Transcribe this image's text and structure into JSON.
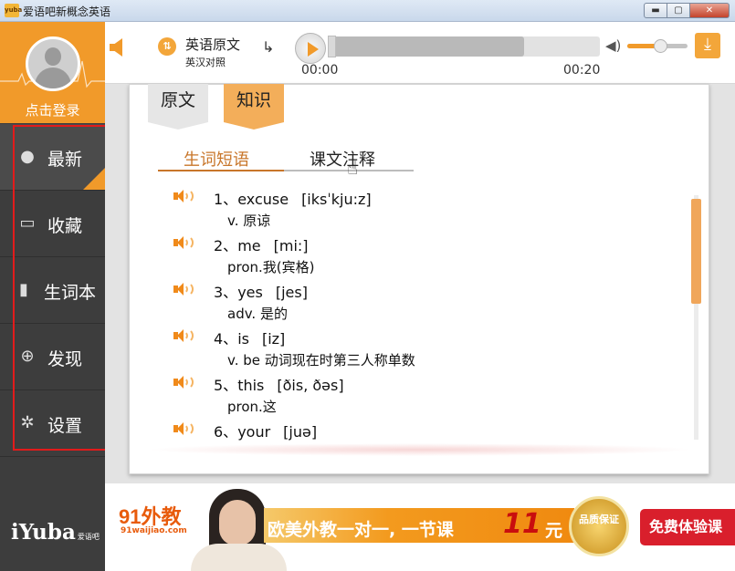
{
  "window": {
    "title": "爱语吧新概念英语",
    "logo_text": "yuba",
    "min_glyph": "▬",
    "max_glyph": "▢",
    "close_glyph": "✕"
  },
  "sidebar": {
    "login_label": "点击登录",
    "items": [
      {
        "label": "最新",
        "icon": "new-icon",
        "glyph": "●"
      },
      {
        "label": "收藏",
        "icon": "folder-icon",
        "glyph": "▭"
      },
      {
        "label": "生词本",
        "icon": "book-icon",
        "glyph": "▮"
      },
      {
        "label": "发现",
        "icon": "compass-icon",
        "glyph": "⊕"
      },
      {
        "label": "设置",
        "icon": "gear-icon",
        "glyph": "✲"
      }
    ],
    "brand": "iYuba",
    "brand_small": "爱语吧"
  },
  "player": {
    "mode_glyph": "⇅",
    "mode_title": "英语原文",
    "mode_subtitle": "英汉对照",
    "repeat_glyph": "↳",
    "current_time": "00:00",
    "total_time": "00:20",
    "progress": 0.72,
    "volume": 0.55,
    "volume_glyph": "◀)",
    "download_glyph": "⤓"
  },
  "tabs": {
    "original": "原文",
    "knowledge": "知识"
  },
  "subtabs": {
    "words": "生词短语",
    "notes": "课文注释"
  },
  "words": [
    {
      "index": "1、",
      "word": "excuse",
      "phonetic": "[iksˈkju:z]",
      "definition": "v. 原谅"
    },
    {
      "index": "2、",
      "word": "me",
      "phonetic": "[mi:]",
      "definition": "pron.我(宾格)"
    },
    {
      "index": "3、",
      "word": "yes",
      "phonetic": "[jes]",
      "definition": "adv. 是的"
    },
    {
      "index": "4、",
      "word": "is",
      "phonetic": "[iz]",
      "definition": "v. be 动词现在时第三人称单数"
    },
    {
      "index": "5、",
      "word": "this",
      "phonetic": "[ðis, ðəs]",
      "definition": "pron.这"
    },
    {
      "index": "6、",
      "word": "your",
      "phonetic": "[juə]",
      "definition": ""
    }
  ],
  "ad": {
    "logo": "91外教",
    "site": "91waijiao.com",
    "slogan": "欧美外教一对一, 一节课",
    "price": "11",
    "unit": "元",
    "seal": "品质保证",
    "cta": "免费体验课"
  },
  "colors": {
    "accent": "#f19a2a",
    "sidebar_bg": "#3d3d3d",
    "highlight": "#e21b1b"
  }
}
